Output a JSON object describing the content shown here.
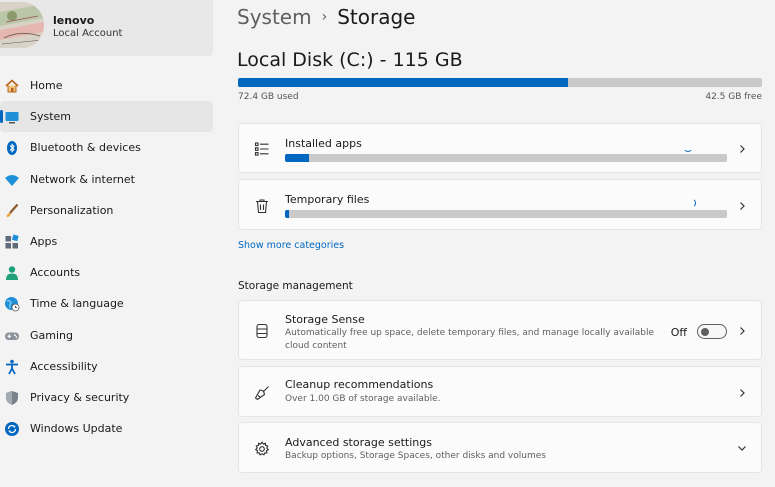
{
  "user": {
    "name": "lenovo",
    "account_type": "Local Account"
  },
  "nav": [
    {
      "label": "Home",
      "icon": "home-icon",
      "active": false
    },
    {
      "label": "System",
      "icon": "monitor-icon",
      "active": true
    },
    {
      "label": "Bluetooth & devices",
      "icon": "bluetooth-icon",
      "active": false
    },
    {
      "label": "Network & internet",
      "icon": "wifi-icon",
      "active": false
    },
    {
      "label": "Personalization",
      "icon": "brush-icon",
      "active": false
    },
    {
      "label": "Apps",
      "icon": "apps-icon",
      "active": false
    },
    {
      "label": "Accounts",
      "icon": "person-icon",
      "active": false
    },
    {
      "label": "Time & language",
      "icon": "globe-clock-icon",
      "active": false
    },
    {
      "label": "Gaming",
      "icon": "gamepad-icon",
      "active": false
    },
    {
      "label": "Accessibility",
      "icon": "accessibility-icon",
      "active": false
    },
    {
      "label": "Privacy & security",
      "icon": "shield-icon",
      "active": false
    },
    {
      "label": "Windows Update",
      "icon": "update-icon",
      "active": false
    }
  ],
  "breadcrumb": {
    "parent": "System",
    "separator": "›",
    "current": "Storage"
  },
  "disk": {
    "title": "Local Disk (C:) - 115 GB",
    "used_label": "72.4 GB used",
    "free_label": "42.5 GB free",
    "used_fraction": 0.63
  },
  "categories": [
    {
      "title": "Installed apps",
      "icon": "list-icon",
      "fill_fraction": 0.055
    },
    {
      "title": "Temporary files",
      "icon": "trash-icon",
      "fill_fraction": 0.008
    }
  ],
  "show_more_label": "Show more categories",
  "management": {
    "section_title": "Storage management",
    "storage_sense": {
      "title": "Storage Sense",
      "description": "Automatically free up space, delete temporary files, and manage locally available cloud content",
      "toggle_label": "Off",
      "enabled": false
    },
    "cleanup": {
      "title": "Cleanup recommendations",
      "description": "Over 1.00 GB of storage available."
    },
    "advanced": {
      "title": "Advanced storage settings",
      "description": "Backup options, Storage Spaces, other disks and volumes"
    }
  },
  "colors": {
    "accent": "#0067c0",
    "bar_track": "#c9c9c9",
    "background": "#f3f3f3",
    "card": "#fbfbfb"
  }
}
